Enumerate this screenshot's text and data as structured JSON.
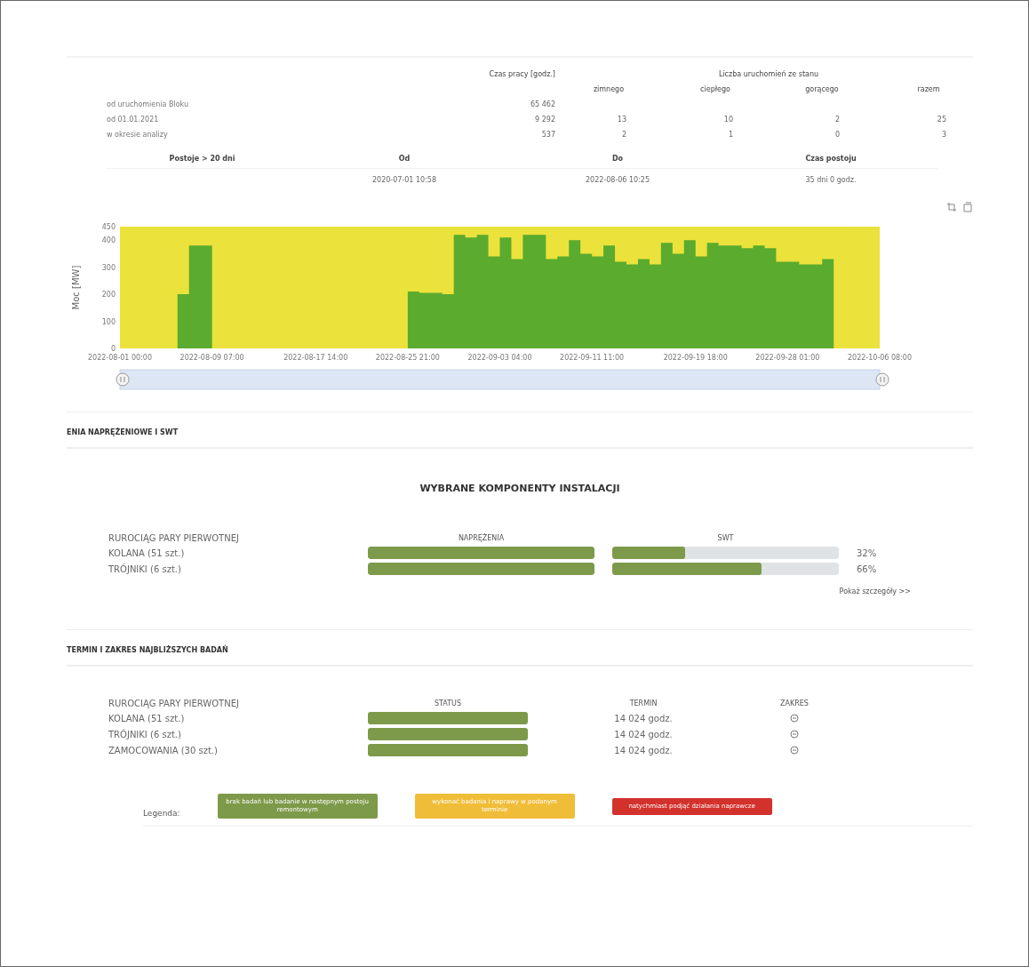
{
  "work_table": {
    "hours_header": "Czas pracy [godz.]",
    "starts_header": "Liczba uruchomień ze stanu",
    "start_columns": [
      "zimnego",
      "ciepłego",
      "gorącego",
      "razem"
    ],
    "rows": [
      {
        "label": "od uruchomienia Bloku",
        "hours": "65 462",
        "starts": []
      },
      {
        "label": "od 01.01.2021",
        "hours": "9 292",
        "starts": [
          "13",
          "10",
          "2",
          "25"
        ]
      },
      {
        "label": "w okresie analizy",
        "hours": "537",
        "starts": [
          "2",
          "1",
          "0",
          "3"
        ]
      }
    ]
  },
  "outage_table": {
    "columns": [
      "Postoje > 20 dni",
      "Od",
      "Do",
      "Czas postoju"
    ],
    "row": {
      "from": "2020-07-01 10:58",
      "to": "2022-08-06 10:25",
      "duration": "35 dni 0 godz."
    }
  },
  "chart": {
    "chart_data": {
      "type": "area",
      "ylabel": "Moc [MW]",
      "categories": [
        "2022-08-01 00:00",
        null,
        null,
        null,
        null,
        null,
        null,
        null,
        "2022-08-09 07:00",
        null,
        null,
        null,
        null,
        null,
        null,
        null,
        null,
        "2022-08-17 14:00",
        null,
        null,
        null,
        null,
        null,
        null,
        null,
        "2022-08-25 21:00",
        null,
        null,
        null,
        null,
        null,
        null,
        null,
        "2022-09-03 04:00",
        null,
        null,
        null,
        null,
        null,
        null,
        null,
        "2022-09-11 11:00",
        null,
        null,
        null,
        null,
        null,
        null,
        null,
        null,
        "2022-09-19 18:00",
        null,
        null,
        null,
        null,
        null,
        null,
        null,
        "2022-09-28 01:00",
        null,
        null,
        null,
        null,
        null,
        null,
        null,
        "2022-10-06 08:00"
      ],
      "series": [
        {
          "color": "#5aab2e",
          "values": [
            0,
            0,
            0,
            0,
            0,
            200,
            380,
            380,
            0,
            0,
            0,
            0,
            0,
            0,
            0,
            0,
            0,
            0,
            0,
            0,
            0,
            0,
            0,
            0,
            0,
            210,
            205,
            205,
            200,
            420,
            410,
            420,
            340,
            410,
            330,
            420,
            420,
            330,
            340,
            400,
            350,
            340,
            380,
            320,
            310,
            330,
            310,
            390,
            350,
            400,
            340,
            390,
            380,
            380,
            370,
            380,
            370,
            320,
            320,
            310,
            310,
            330,
            0,
            0,
            0,
            0,
            0
          ]
        }
      ],
      "ylim": [
        0,
        450
      ],
      "yticks": [
        0,
        100,
        200,
        300,
        400,
        450
      ]
    }
  },
  "stress_section": {
    "title": "ENIA NAPRĘŻENIOWE I SWT",
    "heading": "WYBRANE KOMPONENTY INSTALACJI",
    "group": "RUROCIĄG PARY PIERWOTNEJ",
    "columns": [
      "NAPRĘŻENIA",
      "SWT"
    ],
    "rows": [
      {
        "label": "KOLANA (51 szt.)",
        "stress": {
          "level": 1
        },
        "swt": {
          "level": 0.32
        },
        "reading": "32%"
      },
      {
        "label": "TRÓJNIKI (6 szt.)",
        "stress": {
          "level": 1
        },
        "swt": {
          "level": 0.66
        },
        "reading": "66%"
      }
    ],
    "details_link": "Pokaż szczegóły >>"
  },
  "tests_section": {
    "title": "TERMIN I ZAKRES NAJBLIŻSZYCH BADAŃ",
    "group": "RUROCIĄG PARY PIERWOTNEJ",
    "columns": [
      "STATUS",
      "TERMIN",
      "ZAKRES"
    ],
    "rows": [
      {
        "label": "KOLANA (51 szt.)",
        "color": "#7d9a4a",
        "term": "14 024 godz."
      },
      {
        "label": "TRÓJNIKI (6 szt.)",
        "color": "#7d9a4a",
        "term": "14 024 godz."
      },
      {
        "label": "ZAMOCOWANIA (30 szt.)",
        "color": "#7d9a4a",
        "term": "14 024 godz."
      }
    ],
    "legend_label": "Legenda:",
    "legend": [
      {
        "text": "brak badań lub badanie w następnym postoju remontowym",
        "color": "#7d9a4a"
      },
      {
        "text": "wykonać badania i naprawy w podanym terminie",
        "color": "#f0bd38"
      },
      {
        "text": "natychmiast podjąć działania naprawcze",
        "color": "#d2312c"
      }
    ]
  }
}
